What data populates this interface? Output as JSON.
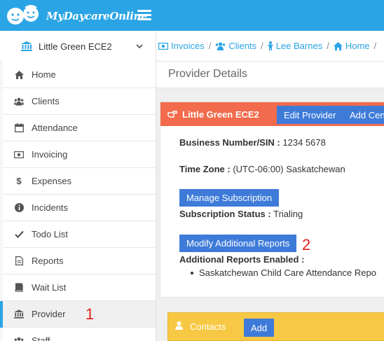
{
  "app": {
    "logo_text": "MyDaycareOnline"
  },
  "colors": {
    "topbar": "#2aa4e5",
    "panel_header": "#f26b4c",
    "contacts_header": "#f7c843",
    "button": "#3e7bd9",
    "annotation": "#e0241c"
  },
  "sidebar": {
    "provider_name": "Little Green ECE2",
    "items": [
      {
        "label": "Home",
        "icon": "home-icon"
      },
      {
        "label": "Clients",
        "icon": "users-icon"
      },
      {
        "label": "Attendance",
        "icon": "calendar-icon"
      },
      {
        "label": "Invoicing",
        "icon": "money-icon"
      },
      {
        "label": "Expenses",
        "icon": "dollar-icon"
      },
      {
        "label": "Incidents",
        "icon": "info-icon"
      },
      {
        "label": "Todo List",
        "icon": "check-icon"
      },
      {
        "label": "Reports",
        "icon": "file-icon"
      },
      {
        "label": "Wait List",
        "icon": "book-icon"
      },
      {
        "label": "Provider",
        "icon": "bank-icon"
      },
      {
        "label": "Staff",
        "icon": "users-icon"
      }
    ]
  },
  "annotations": {
    "provider": "1",
    "modify_reports": "2"
  },
  "breadcrumb": [
    "Invoices",
    "Clients",
    "Lee Barnes",
    "Home"
  ],
  "page": {
    "title": "Provider Details"
  },
  "provider_panel": {
    "title": "Little Green ECE2",
    "edit_button": "Edit Provider",
    "add_center_button": "Add Cent",
    "business_number_label": "Business Number/SIN :",
    "business_number_value": "1234 5678",
    "time_zone_label": "Time Zone :",
    "time_zone_value": "(UTC-06:00) Saskatchewan",
    "manage_subscription_button": "Manage Subscription",
    "subscription_status_label": "Subscription Status :",
    "subscription_status_value": "Trialing",
    "modify_reports_button": "Modify Additional Reports",
    "reports_enabled_label": "Additional Reports Enabled :",
    "reports_enabled": [
      "Saskatchewan Child Care Attendance Repo"
    ]
  },
  "contacts_panel": {
    "title": "Contacts",
    "add_button": "Add"
  }
}
